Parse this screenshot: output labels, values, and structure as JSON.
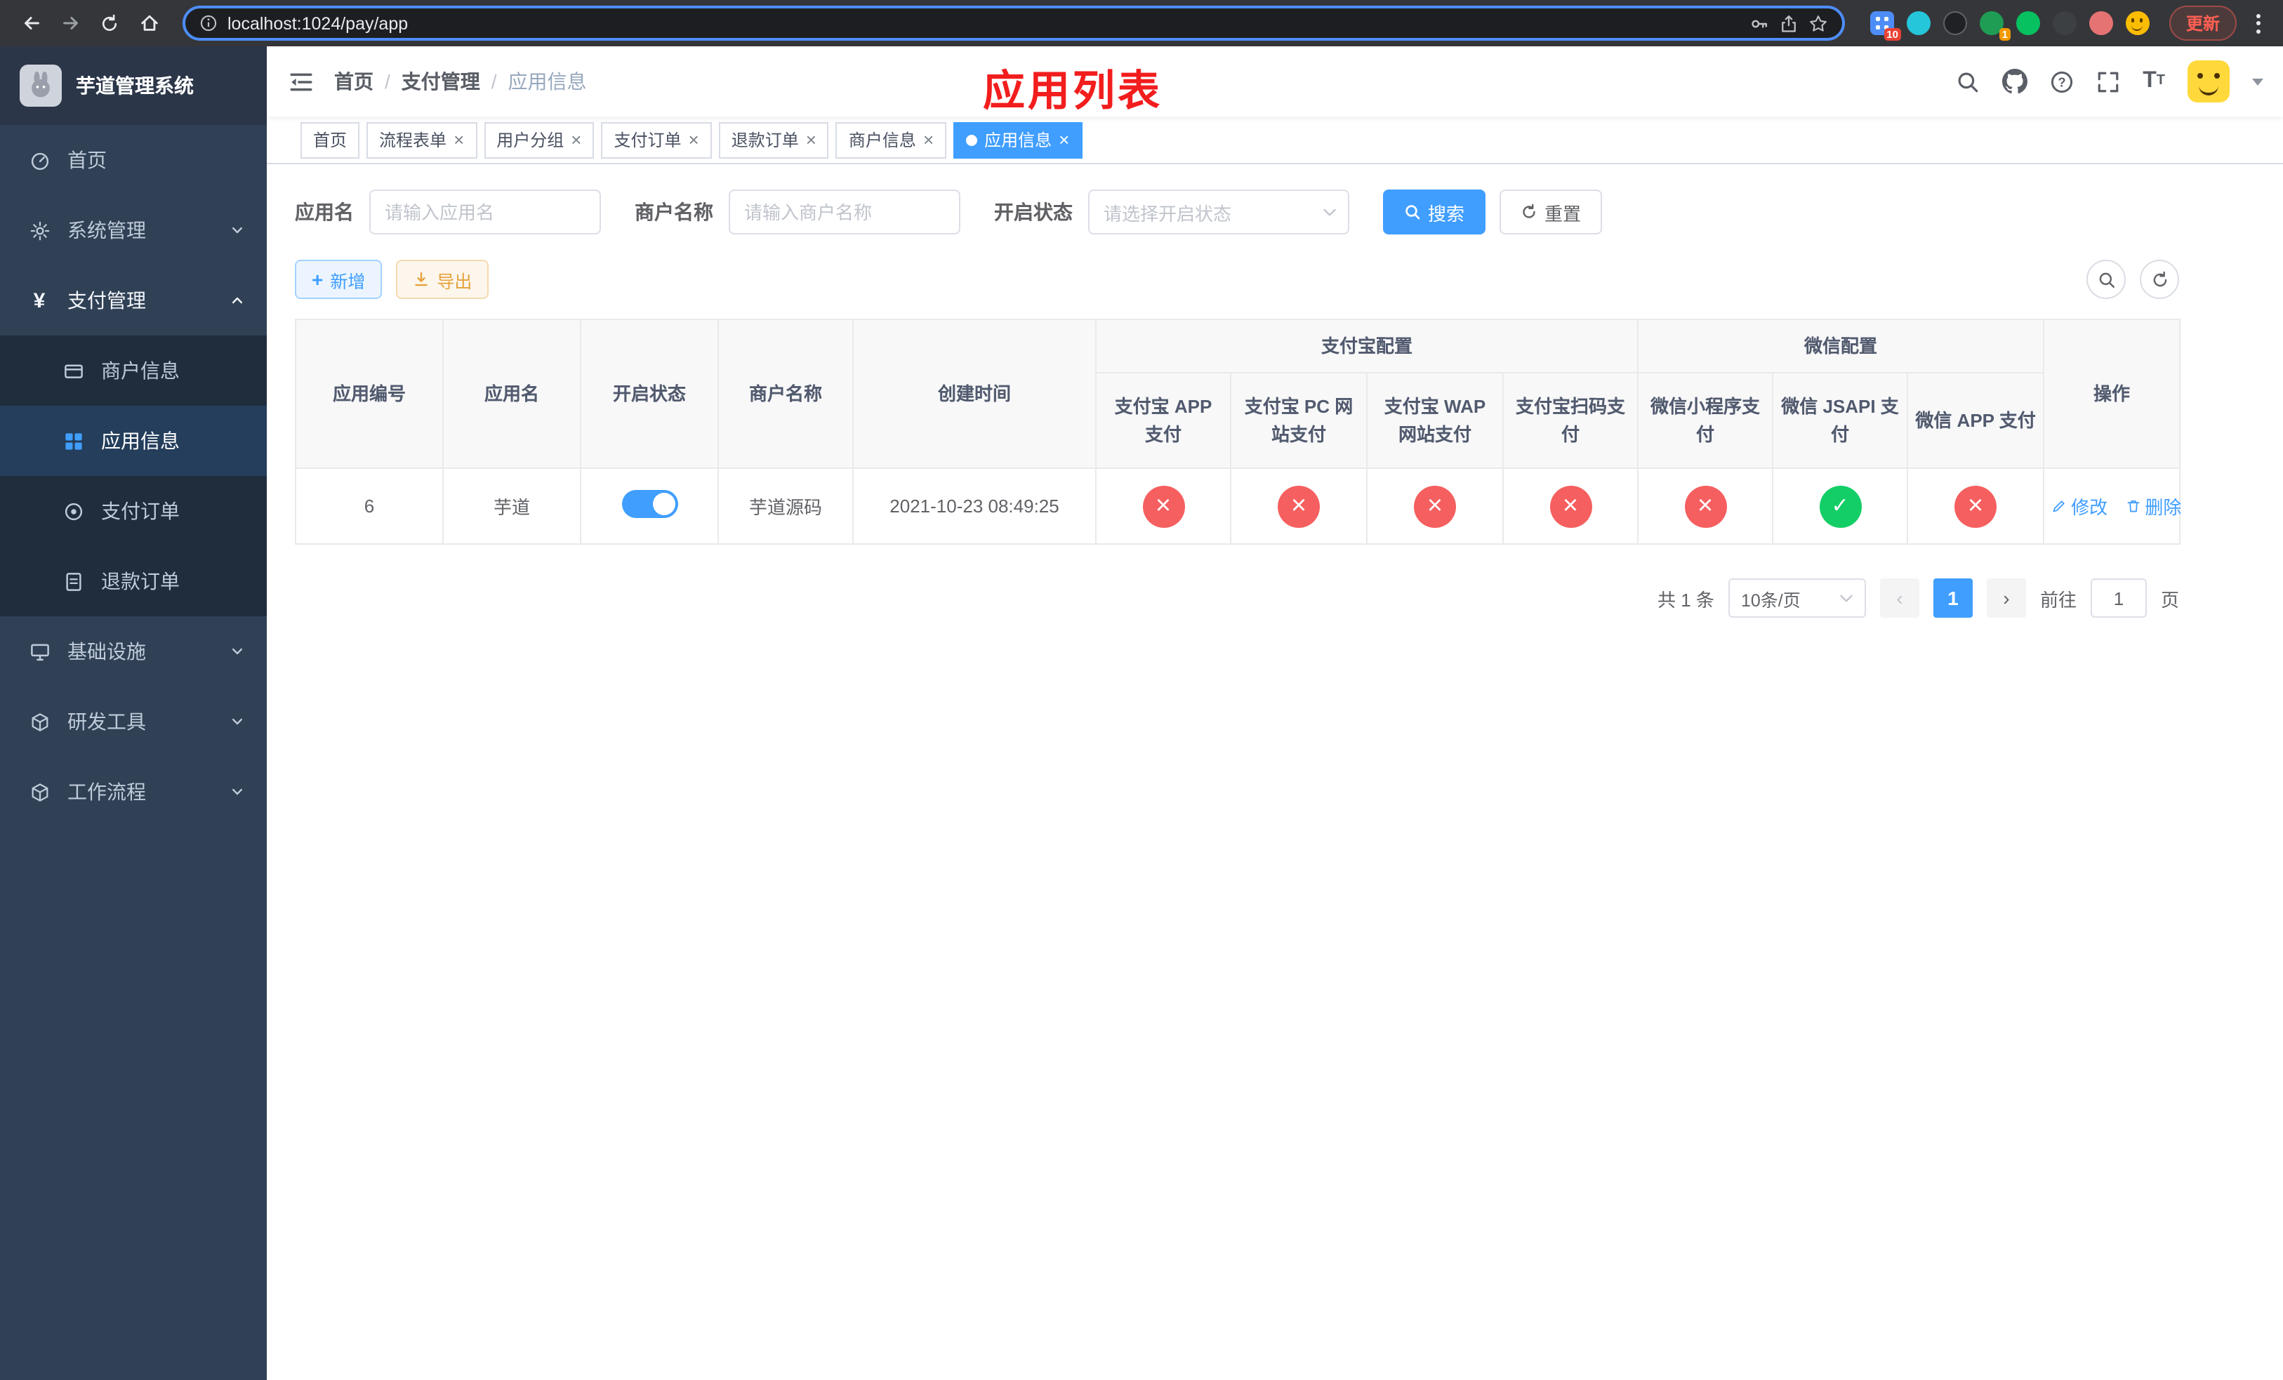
{
  "browser": {
    "url": "localhost:1024/pay/app",
    "update_label": "更新",
    "ext_badge_puzzle": "10",
    "ext_badge_green": "1"
  },
  "sidebar": {
    "title": "芋道管理系统",
    "items": {
      "home": "首页",
      "system": "系统管理",
      "payment": "支付管理",
      "merchant": "商户信息",
      "app_info": "应用信息",
      "pay_order": "支付订单",
      "refund_order": "退款订单",
      "infra": "基础设施",
      "dev": "研发工具",
      "workflow": "工作流程"
    }
  },
  "header": {
    "breadcrumb": {
      "home": "首页",
      "payment": "支付管理",
      "app_info": "应用信息"
    },
    "annotation": "应用列表"
  },
  "tabs": {
    "items": [
      {
        "label": "首页",
        "active": false,
        "closable": false
      },
      {
        "label": "流程表单",
        "active": false,
        "closable": true
      },
      {
        "label": "用户分组",
        "active": false,
        "closable": true
      },
      {
        "label": "支付订单",
        "active": false,
        "closable": true
      },
      {
        "label": "退款订单",
        "active": false,
        "closable": true
      },
      {
        "label": "商户信息",
        "active": false,
        "closable": true
      },
      {
        "label": "应用信息",
        "active": true,
        "closable": true
      }
    ]
  },
  "filters": {
    "app_name_label": "应用名",
    "app_name_placeholder": "请输入应用名",
    "merchant_label": "商户名称",
    "merchant_placeholder": "请输入商户名称",
    "status_label": "开启状态",
    "status_placeholder": "请选择开启状态",
    "search_label": "搜索",
    "reset_label": "重置"
  },
  "toolbar": {
    "add_label": "新增",
    "export_label": "导出"
  },
  "table": {
    "group_alipay": "支付宝配置",
    "group_wechat": "微信配置",
    "columns": [
      "应用编号",
      "应用名",
      "开启状态",
      "商户名称",
      "创建时间",
      "支付宝 APP 支付",
      "支付宝 PC 网站支付",
      "支付宝 WAP 网站支付",
      "支付宝扫码支付",
      "微信小程序支付",
      "微信 JSAPI 支付",
      "微信 APP 支付",
      "操作"
    ],
    "rows": [
      {
        "id": "6",
        "name": "芋道",
        "enabled": true,
        "switch_class": "switch-on",
        "merchant": "芋道源码",
        "created": "2021-10-23 08:49:25",
        "status_classes": [
          "status-no",
          "status-no",
          "status-no",
          "status-no",
          "status-no",
          "status-ok",
          "status-no"
        ],
        "edit_label": "修改",
        "delete_label": "删除"
      }
    ]
  },
  "pagination": {
    "total": "共 1 条",
    "page_size": "10条/页",
    "page": "1",
    "goto_prefix": "前往",
    "goto_value": "1",
    "goto_suffix": "页"
  },
  "colors": {
    "primary": "#409eff",
    "status_fail": "#f65f5f",
    "status_ok": "#13ce66",
    "warning_text": "#e6a23c",
    "annotation_red": "#f21d1d",
    "sidebar_bg": "#304156"
  }
}
